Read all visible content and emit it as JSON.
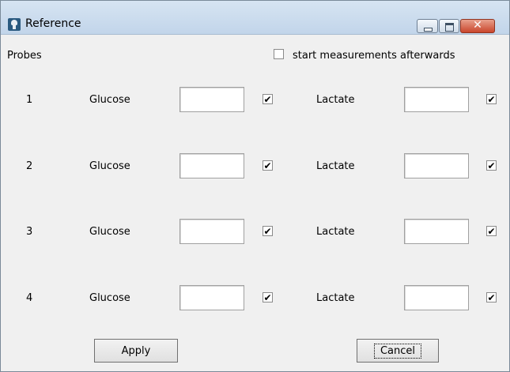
{
  "window": {
    "title": "Reference",
    "controls": {
      "minimize": "minimize-icon",
      "maximize": "maximize-icon",
      "close": "close-icon",
      "close_glyph": "✕"
    }
  },
  "header": {
    "probes_label": "Probes",
    "start_measurements": {
      "label": "start measurements afterwards",
      "checked": false
    }
  },
  "rows": [
    {
      "number": "1",
      "glucose_label": "Glucose",
      "glucose_value": "",
      "glucose_checked": true,
      "glucose_mark": "✔",
      "lactate_label": "Lactate",
      "lactate_value": "",
      "lactate_checked": true,
      "lactate_mark": "✔"
    },
    {
      "number": "2",
      "glucose_label": "Glucose",
      "glucose_value": "",
      "glucose_checked": true,
      "glucose_mark": "✔",
      "lactate_label": "Lactate",
      "lactate_value": "",
      "lactate_checked": true,
      "lactate_mark": "✔"
    },
    {
      "number": "3",
      "glucose_label": "Glucose",
      "glucose_value": "",
      "glucose_checked": true,
      "glucose_mark": "✔",
      "lactate_label": "Lactate",
      "lactate_value": "",
      "lactate_checked": true,
      "lactate_mark": "✔"
    },
    {
      "number": "4",
      "glucose_label": "Glucose",
      "glucose_value": "",
      "glucose_checked": true,
      "glucose_mark": "✔",
      "lactate_label": "Lactate",
      "lactate_value": "",
      "lactate_checked": true,
      "lactate_mark": "✔"
    }
  ],
  "buttons": {
    "apply_label": "Apply",
    "cancel_label": "Cancel"
  },
  "colors": {
    "titlebar": "#c8d9ec",
    "close_button": "#c9462c",
    "dialog_background": "#f0f0f0"
  }
}
